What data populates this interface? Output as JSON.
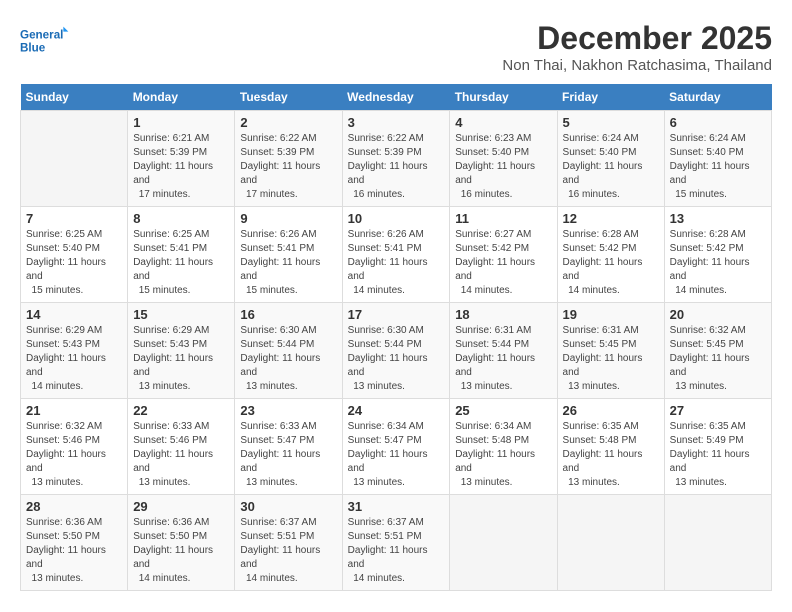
{
  "logo": {
    "line1": "General",
    "line2": "Blue"
  },
  "title": "December 2025",
  "location": "Non Thai, Nakhon Ratchasima, Thailand",
  "days_of_week": [
    "Sunday",
    "Monday",
    "Tuesday",
    "Wednesday",
    "Thursday",
    "Friday",
    "Saturday"
  ],
  "weeks": [
    [
      {
        "day": null
      },
      {
        "day": 1,
        "sunrise": "6:21 AM",
        "sunset": "5:39 PM",
        "daylight": "11 hours and 17 minutes."
      },
      {
        "day": 2,
        "sunrise": "6:22 AM",
        "sunset": "5:39 PM",
        "daylight": "11 hours and 17 minutes."
      },
      {
        "day": 3,
        "sunrise": "6:22 AM",
        "sunset": "5:39 PM",
        "daylight": "11 hours and 16 minutes."
      },
      {
        "day": 4,
        "sunrise": "6:23 AM",
        "sunset": "5:40 PM",
        "daylight": "11 hours and 16 minutes."
      },
      {
        "day": 5,
        "sunrise": "6:24 AM",
        "sunset": "5:40 PM",
        "daylight": "11 hours and 16 minutes."
      },
      {
        "day": 6,
        "sunrise": "6:24 AM",
        "sunset": "5:40 PM",
        "daylight": "11 hours and 15 minutes."
      }
    ],
    [
      {
        "day": 7,
        "sunrise": "6:25 AM",
        "sunset": "5:40 PM",
        "daylight": "11 hours and 15 minutes."
      },
      {
        "day": 8,
        "sunrise": "6:25 AM",
        "sunset": "5:41 PM",
        "daylight": "11 hours and 15 minutes."
      },
      {
        "day": 9,
        "sunrise": "6:26 AM",
        "sunset": "5:41 PM",
        "daylight": "11 hours and 15 minutes."
      },
      {
        "day": 10,
        "sunrise": "6:26 AM",
        "sunset": "5:41 PM",
        "daylight": "11 hours and 14 minutes."
      },
      {
        "day": 11,
        "sunrise": "6:27 AM",
        "sunset": "5:42 PM",
        "daylight": "11 hours and 14 minutes."
      },
      {
        "day": 12,
        "sunrise": "6:28 AM",
        "sunset": "5:42 PM",
        "daylight": "11 hours and 14 minutes."
      },
      {
        "day": 13,
        "sunrise": "6:28 AM",
        "sunset": "5:42 PM",
        "daylight": "11 hours and 14 minutes."
      }
    ],
    [
      {
        "day": 14,
        "sunrise": "6:29 AM",
        "sunset": "5:43 PM",
        "daylight": "11 hours and 14 minutes."
      },
      {
        "day": 15,
        "sunrise": "6:29 AM",
        "sunset": "5:43 PM",
        "daylight": "11 hours and 13 minutes."
      },
      {
        "day": 16,
        "sunrise": "6:30 AM",
        "sunset": "5:44 PM",
        "daylight": "11 hours and 13 minutes."
      },
      {
        "day": 17,
        "sunrise": "6:30 AM",
        "sunset": "5:44 PM",
        "daylight": "11 hours and 13 minutes."
      },
      {
        "day": 18,
        "sunrise": "6:31 AM",
        "sunset": "5:44 PM",
        "daylight": "11 hours and 13 minutes."
      },
      {
        "day": 19,
        "sunrise": "6:31 AM",
        "sunset": "5:45 PM",
        "daylight": "11 hours and 13 minutes."
      },
      {
        "day": 20,
        "sunrise": "6:32 AM",
        "sunset": "5:45 PM",
        "daylight": "11 hours and 13 minutes."
      }
    ],
    [
      {
        "day": 21,
        "sunrise": "6:32 AM",
        "sunset": "5:46 PM",
        "daylight": "11 hours and 13 minutes."
      },
      {
        "day": 22,
        "sunrise": "6:33 AM",
        "sunset": "5:46 PM",
        "daylight": "11 hours and 13 minutes."
      },
      {
        "day": 23,
        "sunrise": "6:33 AM",
        "sunset": "5:47 PM",
        "daylight": "11 hours and 13 minutes."
      },
      {
        "day": 24,
        "sunrise": "6:34 AM",
        "sunset": "5:47 PM",
        "daylight": "11 hours and 13 minutes."
      },
      {
        "day": 25,
        "sunrise": "6:34 AM",
        "sunset": "5:48 PM",
        "daylight": "11 hours and 13 minutes."
      },
      {
        "day": 26,
        "sunrise": "6:35 AM",
        "sunset": "5:48 PM",
        "daylight": "11 hours and 13 minutes."
      },
      {
        "day": 27,
        "sunrise": "6:35 AM",
        "sunset": "5:49 PM",
        "daylight": "11 hours and 13 minutes."
      }
    ],
    [
      {
        "day": 28,
        "sunrise": "6:36 AM",
        "sunset": "5:50 PM",
        "daylight": "11 hours and 13 minutes."
      },
      {
        "day": 29,
        "sunrise": "6:36 AM",
        "sunset": "5:50 PM",
        "daylight": "11 hours and 14 minutes."
      },
      {
        "day": 30,
        "sunrise": "6:37 AM",
        "sunset": "5:51 PM",
        "daylight": "11 hours and 14 minutes."
      },
      {
        "day": 31,
        "sunrise": "6:37 AM",
        "sunset": "5:51 PM",
        "daylight": "11 hours and 14 minutes."
      },
      {
        "day": null
      },
      {
        "day": null
      },
      {
        "day": null
      }
    ]
  ],
  "labels": {
    "sunrise": "Sunrise:",
    "sunset": "Sunset:",
    "daylight": "Daylight:"
  }
}
